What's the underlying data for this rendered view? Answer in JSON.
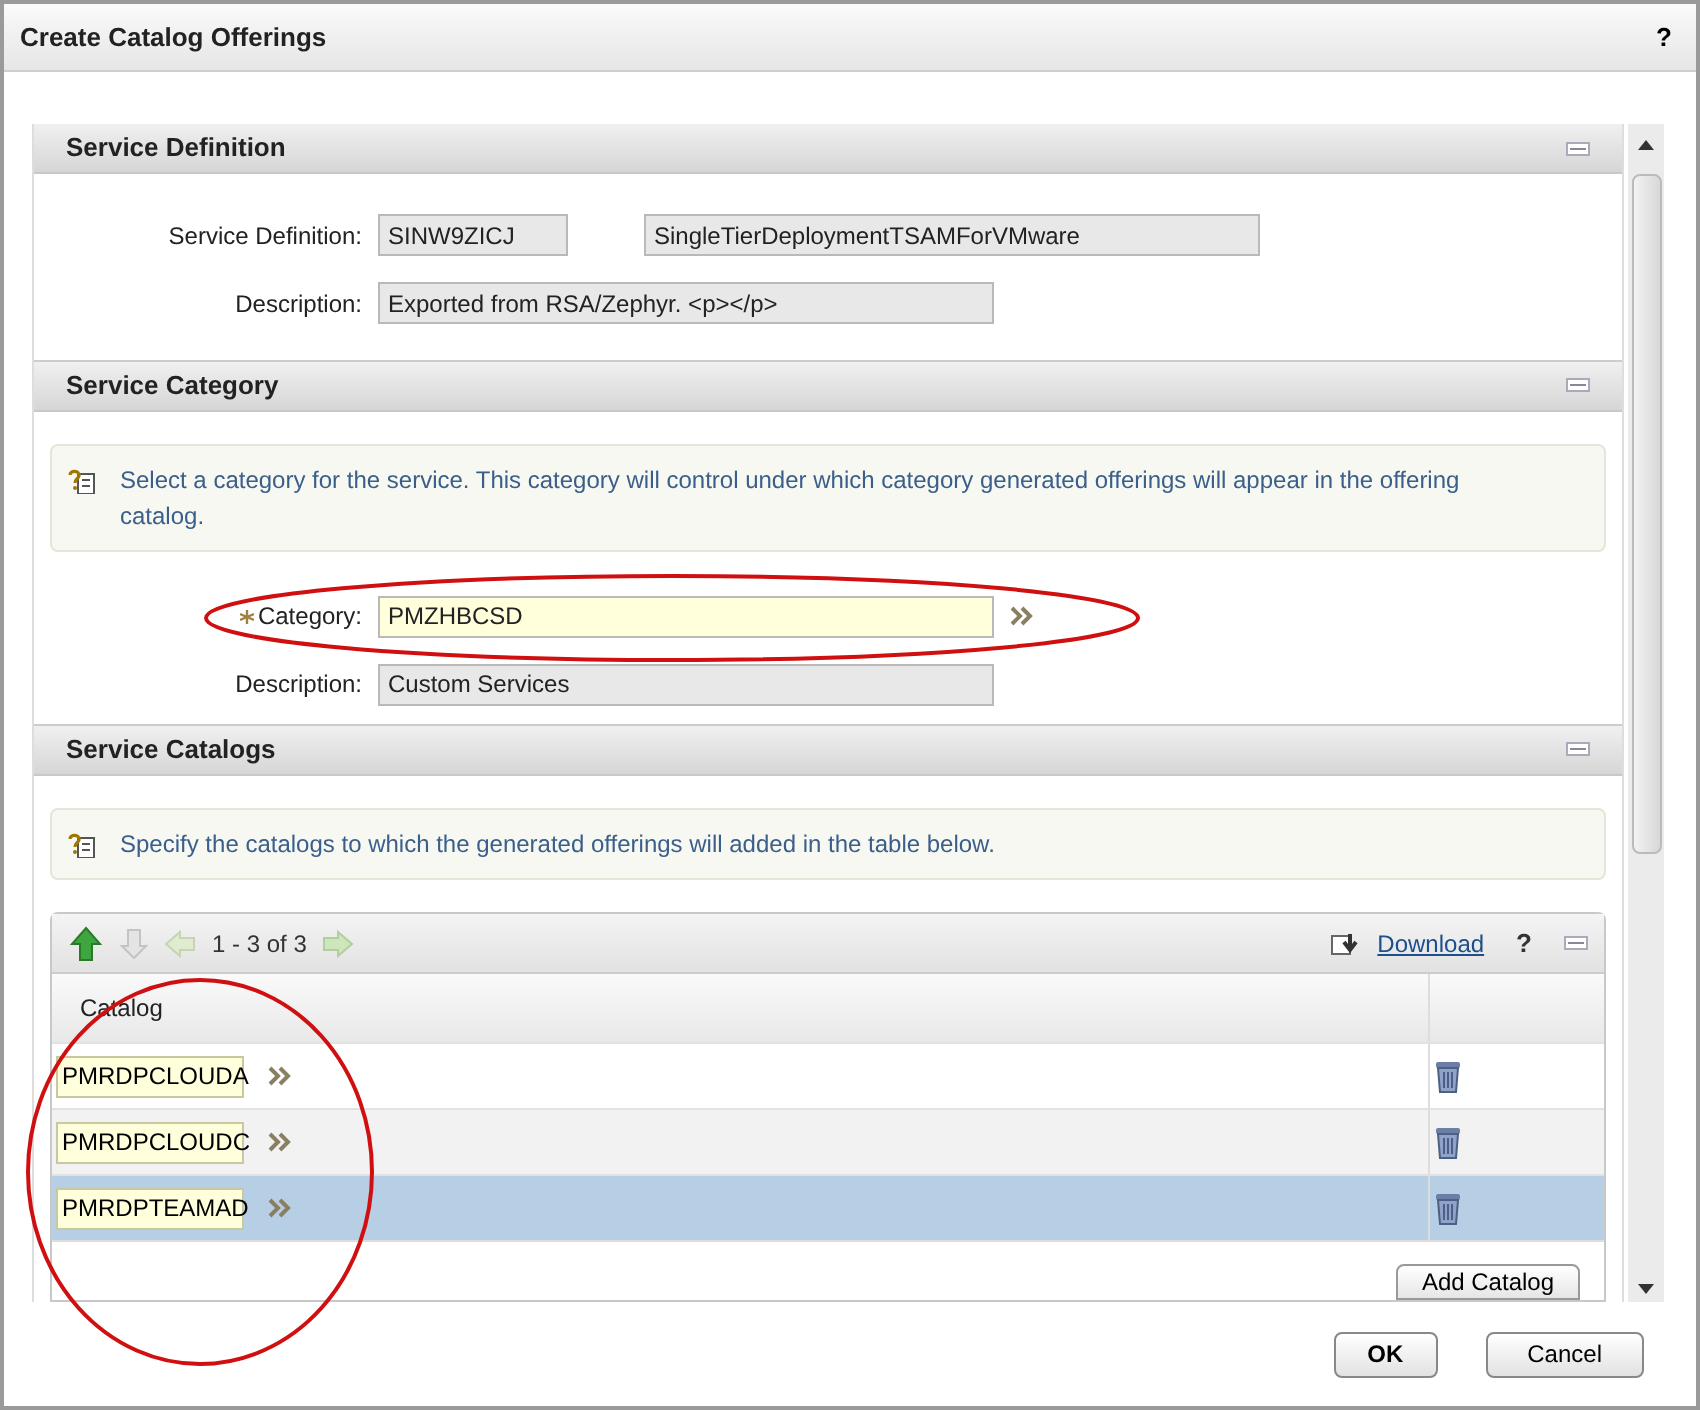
{
  "dialog": {
    "title": "Create Catalog Offerings",
    "help": "?"
  },
  "service_definition": {
    "title": "Service Definition",
    "expanded": true,
    "fields": [
      {
        "label": "Service Definition:",
        "value": "SINW9ZICJ",
        "value_2": "SingleTierDeploymentTSAMForVMware"
      },
      {
        "label": "Description:",
        "value": "Exported from RSA/Zephyr. <p></p>"
      }
    ]
  },
  "service_category": {
    "title": "Service Category",
    "expanded": true,
    "info": "Select a category for the service. This category will control under which category generated offerings will appear in the offering catalog.",
    "category": {
      "label": "Category:",
      "value": "PMZHBCSD",
      "required": true
    },
    "description": {
      "label": "Description:",
      "value": "Custom Services"
    }
  },
  "service_catalogs": {
    "title": "Service Catalogs",
    "expanded": true,
    "info": "Specify the catalogs to which the generated offerings will added in the table below.",
    "table": {
      "pagination": "1 - 3 of 3",
      "download": "Download",
      "help": "?",
      "columns": [
        "Catalog"
      ],
      "rows": [
        {
          "catalog": "PMRDPCLOUDA",
          "selected": false
        },
        {
          "catalog": "PMRDPCLOUDC",
          "selected": false
        },
        {
          "catalog": "PMRDPTEAMAD",
          "selected": true
        }
      ],
      "add_button": "Add Catalog"
    }
  },
  "buttons": [
    "OK",
    "Cancel"
  ]
}
